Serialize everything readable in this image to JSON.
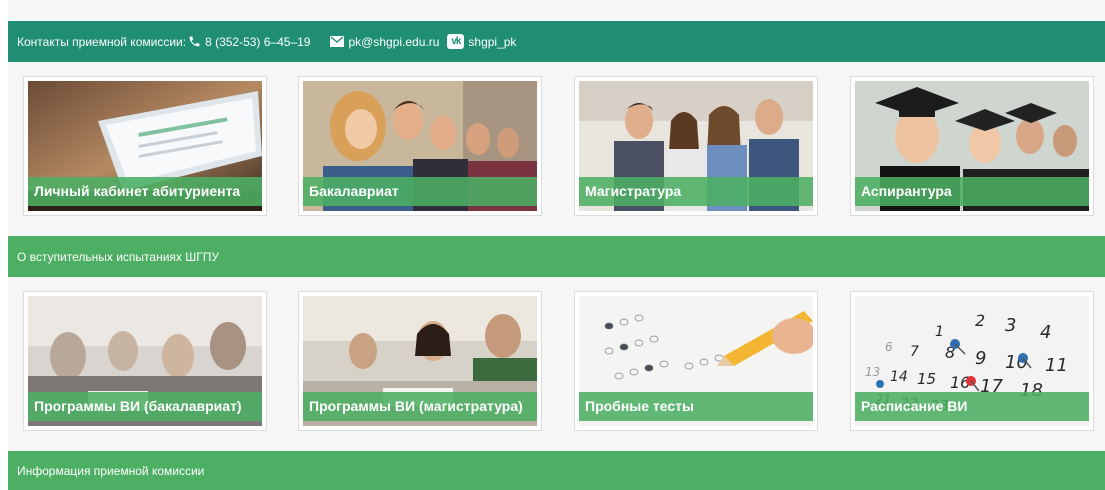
{
  "contacts_bar": {
    "label": "Контакты приемной комиссии:",
    "phone": "8 (352-53) 6–45–19",
    "email": "pk@shgpi.edu.ru",
    "vk_badge": "vk",
    "vk": "shgpi_pk"
  },
  "section_top": {
    "cards": [
      {
        "label": "Личный кабинет абитуриента"
      },
      {
        "label": "Бакалавриат"
      },
      {
        "label": "Магистратура"
      },
      {
        "label": "Аспирантура"
      }
    ]
  },
  "exams_bar": {
    "label": "О вступительных испытаниях ШГПУ"
  },
  "section_exams": {
    "cards": [
      {
        "label": "Программы ВИ (бакалавриат)"
      },
      {
        "label": "Программы ВИ (магистратура)"
      },
      {
        "label": "Пробные тесты"
      },
      {
        "label": "Расписание ВИ"
      }
    ]
  },
  "info_bar": {
    "label": "Информация приемной комиссии"
  },
  "colors": {
    "contacts_bar": "#1f8e73",
    "section_bar": "#4caf63",
    "card_label_bg": "#4caf63",
    "section_bg": "#f6f6f6"
  },
  "icons": [
    "phone-icon",
    "mail-icon",
    "vk-icon"
  ]
}
